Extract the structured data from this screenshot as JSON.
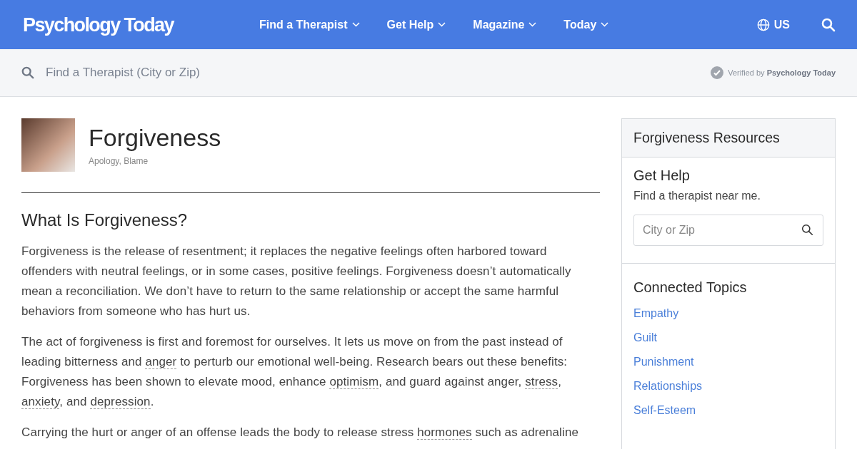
{
  "header": {
    "logo": "Psychology Today",
    "nav": [
      {
        "label": "Find a Therapist"
      },
      {
        "label": "Get Help"
      },
      {
        "label": "Magazine"
      },
      {
        "label": "Today"
      }
    ],
    "region": "US"
  },
  "search_bar": {
    "placeholder": "Find a Therapist (City or Zip)",
    "verified_prefix": "Verified by",
    "verified_brand": "Psychology Today"
  },
  "topic": {
    "title": "Forgiveness",
    "related": "Apology, Blame"
  },
  "article": {
    "heading": "What Is Forgiveness?",
    "paragraphs": [
      [
        {
          "kind": "text",
          "text": "Forgiveness is the release of resentment; it replaces the negative feelings often harbored toward offenders with neutral feelings, or in some cases, positive feelings. Forgiveness doesn’t automatically mean a reconciliation. We don’t have to return to the same relationship or accept the same harmful behaviors from someone who has hurt us."
        }
      ],
      [
        {
          "kind": "text",
          "text": "The act of forgiveness is first and foremost for ourselves. It lets us move on from the past instead of leading bitterness and "
        },
        {
          "kind": "link",
          "text": "anger"
        },
        {
          "kind": "text",
          "text": " to perturb our emotional well-being. Research bears out these benefits: Forgiveness has been shown to elevate mood, enhance "
        },
        {
          "kind": "link",
          "text": "optimism"
        },
        {
          "kind": "text",
          "text": ", and guard against anger, "
        },
        {
          "kind": "link",
          "text": "stress"
        },
        {
          "kind": "text",
          "text": ", "
        },
        {
          "kind": "link",
          "text": "anxiety"
        },
        {
          "kind": "text",
          "text": ", and "
        },
        {
          "kind": "link",
          "text": "depression"
        },
        {
          "kind": "text",
          "text": "."
        }
      ],
      [
        {
          "kind": "text",
          "text": "Carrying the hurt or anger of an offense leads the body to release stress "
        },
        {
          "kind": "link",
          "text": "hormones"
        },
        {
          "kind": "text",
          "text": " such as adrenaline"
        }
      ]
    ]
  },
  "sidebar": {
    "title": "Forgiveness Resources",
    "get_help": {
      "heading": "Get Help",
      "text": "Find a therapist near me.",
      "placeholder": "City or Zip"
    },
    "connected": {
      "heading": "Connected Topics",
      "items": [
        "Empathy",
        "Guilt",
        "Punishment",
        "Relationships",
        "Self-Esteem"
      ]
    }
  }
}
